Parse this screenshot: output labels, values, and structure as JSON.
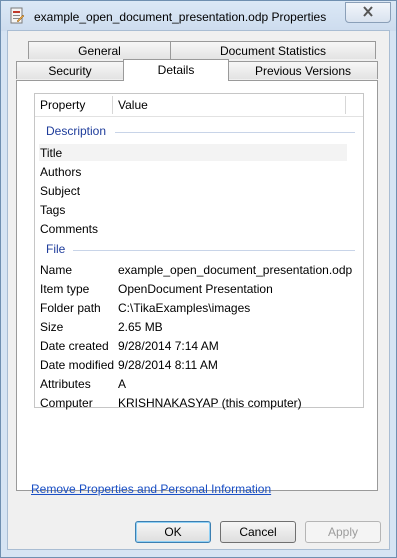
{
  "window": {
    "title": "example_open_document_presentation.odp Properties"
  },
  "tabs": {
    "row1": [
      "General",
      "Document Statistics"
    ],
    "row2": [
      "Security",
      "Details",
      "Previous Versions"
    ],
    "active": "Details"
  },
  "list": {
    "columns": [
      "Property",
      "Value"
    ],
    "groups": {
      "description": "Description",
      "file": "File"
    },
    "description_rows": [
      {
        "label": "Title",
        "value": ""
      },
      {
        "label": "Authors",
        "value": ""
      },
      {
        "label": "Subject",
        "value": ""
      },
      {
        "label": "Tags",
        "value": ""
      },
      {
        "label": "Comments",
        "value": ""
      }
    ],
    "file_rows": [
      {
        "label": "Name",
        "value": "example_open_document_presentation.odp"
      },
      {
        "label": "Item type",
        "value": "OpenDocument Presentation"
      },
      {
        "label": "Folder path",
        "value": "C:\\TikaExamples\\images"
      },
      {
        "label": "Size",
        "value": "2.65 MB"
      },
      {
        "label": "Date created",
        "value": "9/28/2014 7:14 AM"
      },
      {
        "label": "Date modified",
        "value": "9/28/2014 8:11 AM"
      },
      {
        "label": "Attributes",
        "value": "A"
      },
      {
        "label": "Computer",
        "value": "KRISHNAKASYAP (this computer)"
      }
    ]
  },
  "link_text": "Remove Properties and Personal Information",
  "buttons": {
    "ok": "OK",
    "cancel": "Cancel",
    "apply": "Apply"
  },
  "icons": {
    "app": "document-properties-icon",
    "close": "close-icon"
  },
  "colors": {
    "group_heading": "#1e3c9b",
    "link": "#1a4fc4"
  }
}
